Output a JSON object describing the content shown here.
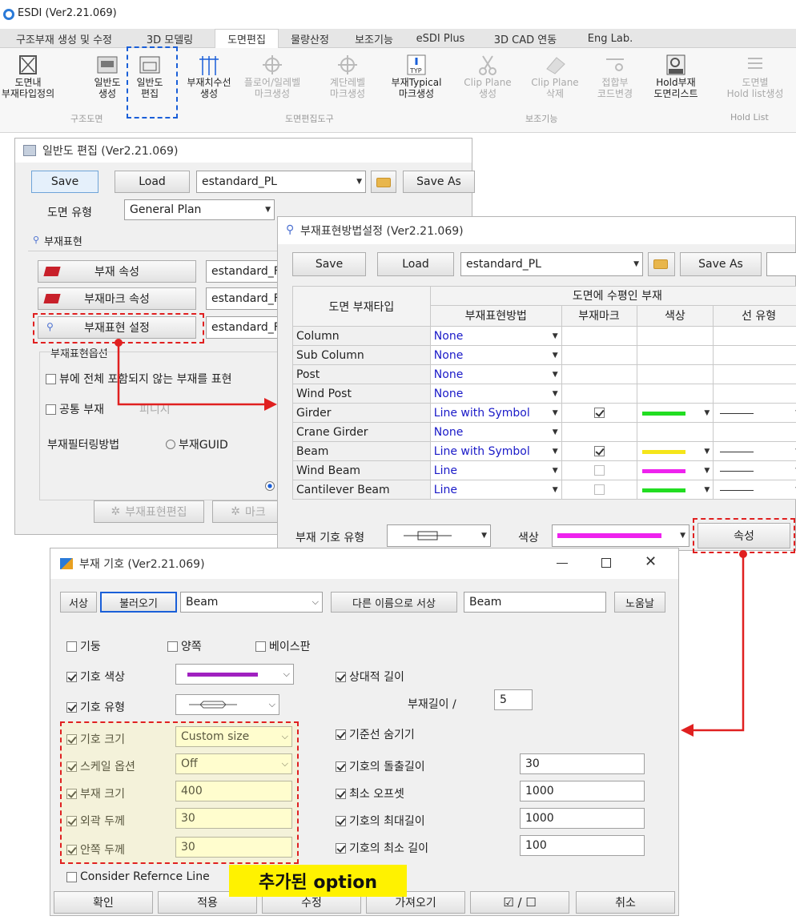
{
  "app": {
    "title": "ESDI (Ver2.21.069)"
  },
  "ribbon": {
    "tabs": [
      "구조부재 생성 및 수정",
      "3D 모델링",
      "도면편집",
      "물량산정",
      "보조기능",
      "eSDI Plus",
      "3D CAD 연동",
      "Eng Lab."
    ],
    "active_tab": "도면편집",
    "buttons": [
      {
        "label": "도면내\n부재타입정의",
        "icon": "member-type-icon"
      },
      {
        "label": "일반도\n생성",
        "icon": "new-drawing-icon"
      },
      {
        "label": "일반도\n편집",
        "icon": "edit-drawing-icon"
      },
      {
        "label": "부재치수선\n생성",
        "icon": "dimension-line-icon"
      },
      {
        "label": "플로어/일레벨\n마크생성",
        "icon": "crosshair-icon"
      },
      {
        "label": "계단레벨\n마크생성",
        "icon": "crosshair-icon"
      },
      {
        "label": "부재Typical\n마크생성",
        "icon": "typical-mark-icon"
      },
      {
        "label": "Clip Plane\n생성",
        "icon": "scissors-icon"
      },
      {
        "label": "Clip Plane\n삭제",
        "icon": "eraser-icon"
      },
      {
        "label": "접합부\n코드변경",
        "icon": "joint-code-icon"
      },
      {
        "label": "Hold부재\n도면리스트",
        "icon": "hold-icon"
      },
      {
        "label": "도면별\nHold list생성",
        "icon": "hold-list-icon"
      }
    ],
    "groups": [
      "구조도면",
      "도면편집도구",
      "보조기능",
      "Hold List"
    ]
  },
  "drawing_edit": {
    "title": "일반도 편집 (Ver2.21.069)",
    "save": "Save",
    "load": "Load",
    "preset": "estandard_PL",
    "save_as": "Save As",
    "type_label": "도면 유형",
    "type_value": "General Plan",
    "section_label": "부재표현",
    "btn_member_attr": "부재 속성",
    "btn_mark_attr": "부재마크 속성",
    "btn_expr_setting": "부재표현 설정",
    "field_value": "estandard_F",
    "options_label": "부재표현옵션",
    "opt_partial": "뷰에 전체 포함되지 않는 부재를 표현",
    "opt_common": "공통 부재",
    "opt_finish": "피니시",
    "filter_label": "부재필터링방법",
    "filter_guid": "부재GUID",
    "btn_expr_edit": "부재표현편집",
    "btn_mark": "마크"
  },
  "expr_settings": {
    "title": "부재표현방법설정 (Ver2.21.069)",
    "save": "Save",
    "load": "Load",
    "preset": "estandard_PL",
    "save_as": "Save As",
    "header_type": "도면 부재타입",
    "header_group": "도면에 수평인 부재",
    "header_method": "부재표현방법",
    "header_mark": "부재마크",
    "header_color": "색상",
    "header_line": "선 유형",
    "rows": [
      {
        "type": "Column",
        "method": "None",
        "mark": null,
        "color": null
      },
      {
        "type": "Sub Column",
        "method": "None",
        "mark": null,
        "color": null
      },
      {
        "type": "Post",
        "method": "None",
        "mark": null,
        "color": null
      },
      {
        "type": "Wind Post",
        "method": "None",
        "mark": null,
        "color": null
      },
      {
        "type": "Girder",
        "method": "Line with Symbol",
        "mark": true,
        "color": "#22dd22"
      },
      {
        "type": "Crane Girder",
        "method": "None",
        "mark": null,
        "color": null
      },
      {
        "type": "Beam",
        "method": "Line with Symbol",
        "mark": true,
        "color": "#f5e51a"
      },
      {
        "type": "Wind Beam",
        "method": "Line",
        "mark": false,
        "color": "#ee22ee"
      },
      {
        "type": "Cantilever Beam",
        "method": "Line",
        "mark": false,
        "color": "#22dd22"
      }
    ],
    "symbol_type_label": "부재 기호 유형",
    "color_label": "색상",
    "symbol_color": "#ee22ee",
    "prop_button": "속성"
  },
  "symbol_dialog": {
    "title": "부재 기호 (Ver2.21.069)",
    "btn_save": "서상",
    "btn_load": "불러오기",
    "load_value": "Beam",
    "btn_save_other": "다른 이름으로 서상",
    "name_value": "Beam",
    "btn_default": "노움날",
    "chk_column": "기둥",
    "chk_both": "양쪽",
    "chk_base": "베이스판",
    "chk_symbol_color": "기호 색상",
    "symbol_color": "#a020c0",
    "chk_symbol_type": "기호 유형",
    "chk_symbol_size": "기호 크기",
    "symbol_size": "Custom size",
    "chk_scale": "스케일 옵션",
    "scale": "Off",
    "chk_member_size": "부재 크기",
    "member_size": "400",
    "chk_outer": "외곽 두께",
    "outer": "30",
    "chk_inner": "안쪽 두께",
    "inner": "30",
    "chk_relative": "상대적 길이",
    "member_len_label": "부재길이 /",
    "member_len": "5",
    "chk_hide_ref": "기준선 숨기기",
    "chk_protrude": "기호의 돌출길이",
    "protrude": "30",
    "chk_min_offset": "최소 오프셋",
    "min_offset": "1000",
    "chk_max_len": "기호의 최대길이",
    "max_len": "1000",
    "chk_min_len": "기호의 최소 길이",
    "min_len": "100",
    "chk_ref_line": "Consider Refernce Line",
    "footer": [
      "확인",
      "적용",
      "수정",
      "가져오기",
      "",
      "취소"
    ],
    "toggle_icon": "☑ / ☐"
  },
  "annotation": {
    "added_option": "추가된 option"
  }
}
